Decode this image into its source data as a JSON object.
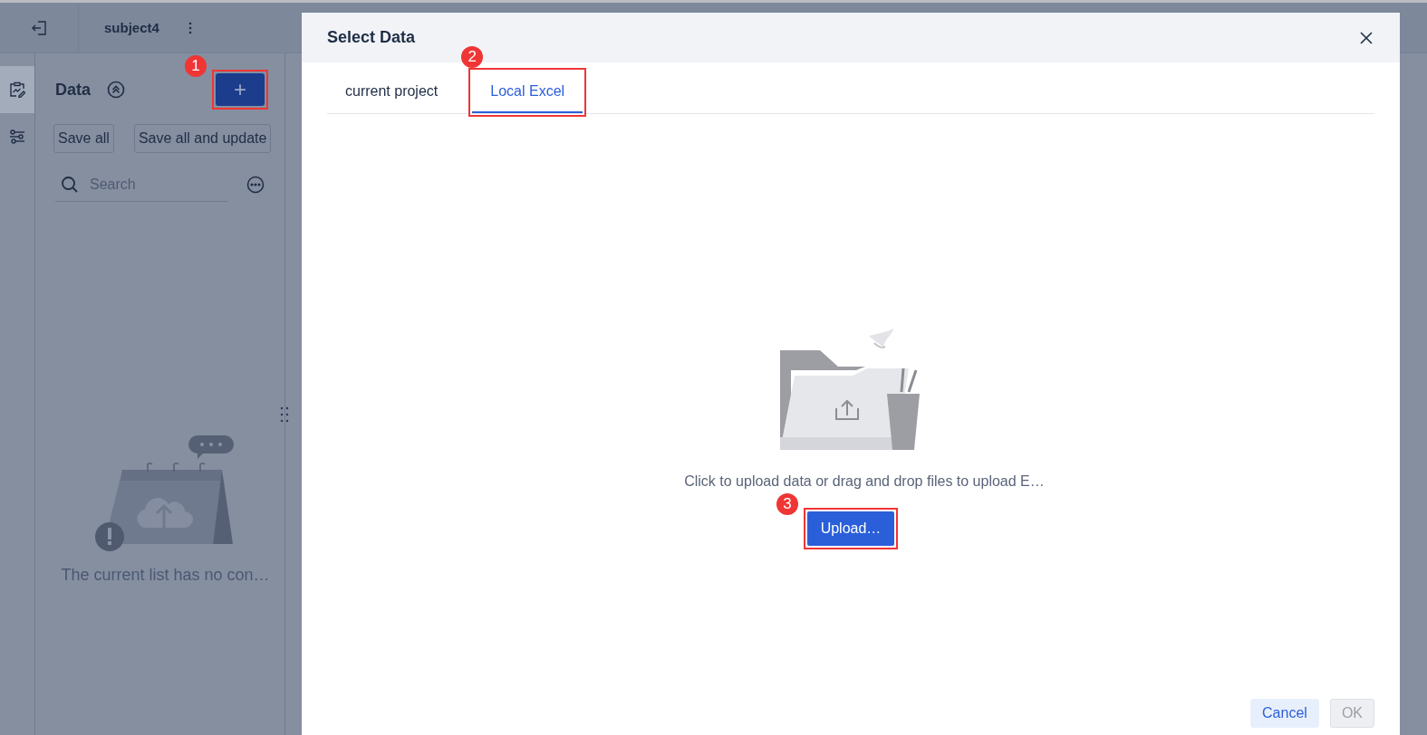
{
  "header": {
    "project_title": "subject4"
  },
  "rail": {
    "items": [
      {
        "selected": true
      },
      {
        "selected": false
      }
    ]
  },
  "data_panel": {
    "title": "Data",
    "add_button": {
      "label": "+",
      "callout": "1"
    },
    "buttons": [
      "Save all",
      "Save all and update"
    ],
    "search": {
      "placeholder": "Search"
    },
    "empty_message": "The current list has no con…"
  },
  "dialog": {
    "title": "Select Data",
    "tabs": [
      {
        "label": "current project",
        "selected": false
      },
      {
        "label": "Local Excel",
        "selected": true,
        "callout": "2"
      }
    ],
    "upload_hint": "Click to upload data or drag and drop files to upload E…",
    "upload_button": {
      "label": "Upload…",
      "callout": "3"
    },
    "buttons": [
      {
        "label": "Cancel",
        "disabled": false
      },
      {
        "label": "OK",
        "disabled": true
      }
    ]
  }
}
